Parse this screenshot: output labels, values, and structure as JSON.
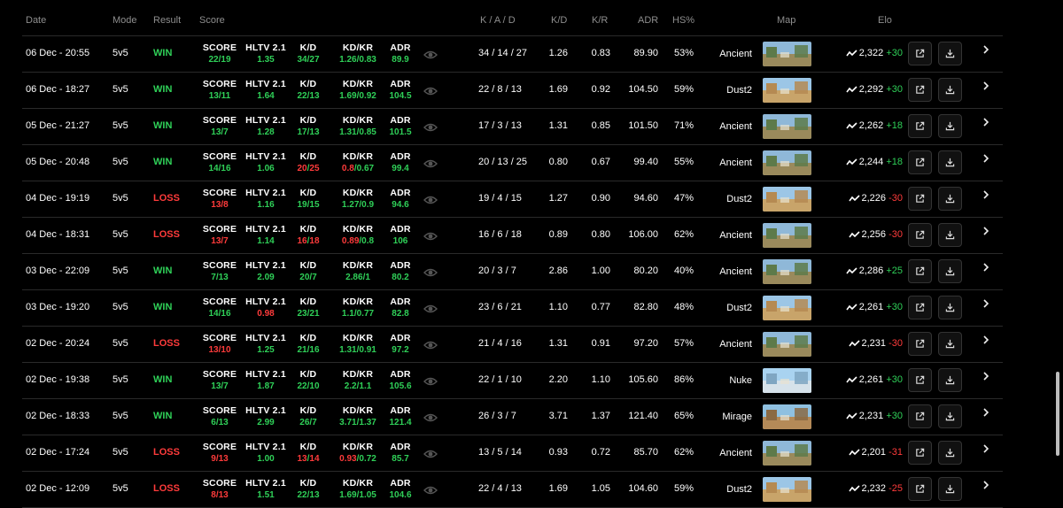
{
  "headers": {
    "date": "Date",
    "mode": "Mode",
    "result": "Result",
    "score": "Score",
    "kad": "K / A / D",
    "kd": "K/D",
    "kr": "K/R",
    "adr": "ADR",
    "hs": "HS%",
    "map": "Map",
    "elo": "Elo"
  },
  "stat_labels": {
    "score": "SCORE",
    "hltv": "HLTV 2.1",
    "kd": "K/D",
    "kdkr": "KD/KR",
    "adr": "ADR"
  },
  "colors": {
    "win": "#2fd058",
    "loss": "#ff3b3b"
  },
  "icons": {
    "eye": "eye-icon",
    "trend": "trend-icon",
    "open": "external-link-icon",
    "download": "download-icon",
    "chevron": "chevron-right-icon"
  },
  "matches": [
    {
      "date": "06 Dec - 20:55",
      "mode": "5v5",
      "result": "WIN",
      "score": [
        "22",
        "19"
      ],
      "hltv": "1.35",
      "kdv": [
        "34",
        "27"
      ],
      "kdkr": [
        "1.26",
        "0.83"
      ],
      "adr": "89.9",
      "kad": "34 / 14 / 27",
      "kd": "1.26",
      "kr": "0.83",
      "adr2": "89.90",
      "hs": "53%",
      "map": "Ancient",
      "elo": "2,322",
      "elo_change": "+30"
    },
    {
      "date": "06 Dec - 18:27",
      "mode": "5v5",
      "result": "WIN",
      "score": [
        "13",
        "11"
      ],
      "hltv": "1.64",
      "kdv": [
        "22",
        "13"
      ],
      "kdkr": [
        "1.69",
        "0.92"
      ],
      "adr": "104.5",
      "kad": "22 / 8 / 13",
      "kd": "1.69",
      "kr": "0.92",
      "adr2": "104.50",
      "hs": "59%",
      "map": "Dust2",
      "elo": "2,292",
      "elo_change": "+30"
    },
    {
      "date": "05 Dec - 21:27",
      "mode": "5v5",
      "result": "WIN",
      "score": [
        "13",
        "7"
      ],
      "hltv": "1.28",
      "kdv": [
        "17",
        "13"
      ],
      "kdkr": [
        "1.31",
        "0.85"
      ],
      "adr": "101.5",
      "kad": "17 / 3 / 13",
      "kd": "1.31",
      "kr": "0.85",
      "adr2": "101.50",
      "hs": "71%",
      "map": "Ancient",
      "elo": "2,262",
      "elo_change": "+18"
    },
    {
      "date": "05 Dec - 20:48",
      "mode": "5v5",
      "result": "WIN",
      "score": [
        "14",
        "16"
      ],
      "hltv": "1.06",
      "kdv": [
        "20",
        "25"
      ],
      "kdkr": [
        "0.8",
        "0.67"
      ],
      "adr": "99.4",
      "kad": "20 / 13 / 25",
      "kd": "0.80",
      "kr": "0.67",
      "adr2": "99.40",
      "hs": "55%",
      "map": "Ancient",
      "elo": "2,244",
      "elo_change": "+18"
    },
    {
      "date": "04 Dec - 19:19",
      "mode": "5v5",
      "result": "LOSS",
      "score": [
        "13",
        "8"
      ],
      "hltv": "1.16",
      "kdv": [
        "19",
        "15"
      ],
      "kdkr": [
        "1.27",
        "0.9"
      ],
      "adr": "94.6",
      "kad": "19 / 4 / 15",
      "kd": "1.27",
      "kr": "0.90",
      "adr2": "94.60",
      "hs": "47%",
      "map": "Dust2",
      "elo": "2,226",
      "elo_change": "-30"
    },
    {
      "date": "04 Dec - 18:31",
      "mode": "5v5",
      "result": "LOSS",
      "score": [
        "13",
        "7"
      ],
      "hltv": "1.14",
      "kdv": [
        "16",
        "18"
      ],
      "kdkr": [
        "0.89",
        "0.8"
      ],
      "adr": "106",
      "kad": "16 / 6 / 18",
      "kd": "0.89",
      "kr": "0.80",
      "adr2": "106.00",
      "hs": "62%",
      "map": "Ancient",
      "elo": "2,256",
      "elo_change": "-30"
    },
    {
      "date": "03 Dec - 22:09",
      "mode": "5v5",
      "result": "WIN",
      "score": [
        "7",
        "13"
      ],
      "hltv": "2.09",
      "kdv": [
        "20",
        "7"
      ],
      "kdkr": [
        "2.86",
        "1"
      ],
      "adr": "80.2",
      "kad": "20 / 3 / 7",
      "kd": "2.86",
      "kr": "1.00",
      "adr2": "80.20",
      "hs": "40%",
      "map": "Ancient",
      "elo": "2,286",
      "elo_change": "+25"
    },
    {
      "date": "03 Dec - 19:20",
      "mode": "5v5",
      "result": "WIN",
      "score": [
        "14",
        "16"
      ],
      "hltv": "0.98",
      "kdv": [
        "23",
        "21"
      ],
      "kdkr": [
        "1.1",
        "0.77"
      ],
      "adr": "82.8",
      "kad": "23 / 6 / 21",
      "kd": "1.10",
      "kr": "0.77",
      "adr2": "82.80",
      "hs": "48%",
      "map": "Dust2",
      "elo": "2,261",
      "elo_change": "+30"
    },
    {
      "date": "02 Dec - 20:24",
      "mode": "5v5",
      "result": "LOSS",
      "score": [
        "13",
        "10"
      ],
      "hltv": "1.25",
      "kdv": [
        "21",
        "16"
      ],
      "kdkr": [
        "1.31",
        "0.91"
      ],
      "adr": "97.2",
      "kad": "21 / 4 / 16",
      "kd": "1.31",
      "kr": "0.91",
      "adr2": "97.20",
      "hs": "57%",
      "map": "Ancient",
      "elo": "2,231",
      "elo_change": "-30"
    },
    {
      "date": "02 Dec - 19:38",
      "mode": "5v5",
      "result": "WIN",
      "score": [
        "13",
        "7"
      ],
      "hltv": "1.87",
      "kdv": [
        "22",
        "10"
      ],
      "kdkr": [
        "2.2",
        "1.1"
      ],
      "adr": "105.6",
      "kad": "22 / 1 / 10",
      "kd": "2.20",
      "kr": "1.10",
      "adr2": "105.60",
      "hs": "86%",
      "map": "Nuke",
      "elo": "2,261",
      "elo_change": "+30"
    },
    {
      "date": "02 Dec - 18:33",
      "mode": "5v5",
      "result": "WIN",
      "score": [
        "6",
        "13"
      ],
      "hltv": "2.99",
      "kdv": [
        "26",
        "7"
      ],
      "kdkr": [
        "3.71",
        "1.37"
      ],
      "adr": "121.4",
      "kad": "26 / 3 / 7",
      "kd": "3.71",
      "kr": "1.37",
      "adr2": "121.40",
      "hs": "65%",
      "map": "Mirage",
      "elo": "2,231",
      "elo_change": "+30"
    },
    {
      "date": "02 Dec - 17:24",
      "mode": "5v5",
      "result": "LOSS",
      "score": [
        "9",
        "13"
      ],
      "hltv": "1.00",
      "kdv": [
        "13",
        "14"
      ],
      "kdkr": [
        "0.93",
        "0.72"
      ],
      "adr": "85.7",
      "kad": "13 / 5 / 14",
      "kd": "0.93",
      "kr": "0.72",
      "adr2": "85.70",
      "hs": "62%",
      "map": "Ancient",
      "elo": "2,201",
      "elo_change": "-31"
    },
    {
      "date": "02 Dec - 12:09",
      "mode": "5v5",
      "result": "LOSS",
      "score": [
        "8",
        "13"
      ],
      "hltv": "1.51",
      "kdv": [
        "22",
        "13"
      ],
      "kdkr": [
        "1.69",
        "1.05"
      ],
      "adr": "104.6",
      "kad": "22 / 4 / 13",
      "kd": "1.69",
      "kr": "1.05",
      "adr2": "104.60",
      "hs": "59%",
      "map": "Dust2",
      "elo": "2,232",
      "elo_change": "-25"
    }
  ]
}
